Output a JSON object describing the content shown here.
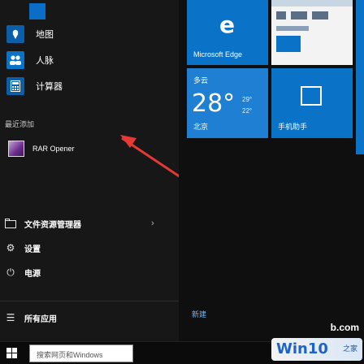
{
  "start_menu": {
    "top_apps": [
      {
        "label": "地图"
      },
      {
        "label": "人脉"
      },
      {
        "label": "计算器"
      }
    ],
    "section_label": "最近添加",
    "recent": [
      {
        "label": "RAR Opener"
      }
    ],
    "menu": [
      {
        "label": "文件资源管理器"
      },
      {
        "label": "设置"
      },
      {
        "label": "电源"
      },
      {
        "label": "所有应用"
      }
    ],
    "new_badge": "新建"
  },
  "tiles": {
    "edge": {
      "label": "Microsoft Edge"
    },
    "weather": {
      "condition": "多云",
      "temp": "28°",
      "high": "29°",
      "low": "22°",
      "city": "北京"
    },
    "phone": {
      "label": "手机助手"
    }
  },
  "taskbar": {
    "search_placeholder": "搜索网页和Windows"
  },
  "watermark": {
    "url": "b.com",
    "brand": "Win10",
    "brand_suffix": "之家"
  }
}
